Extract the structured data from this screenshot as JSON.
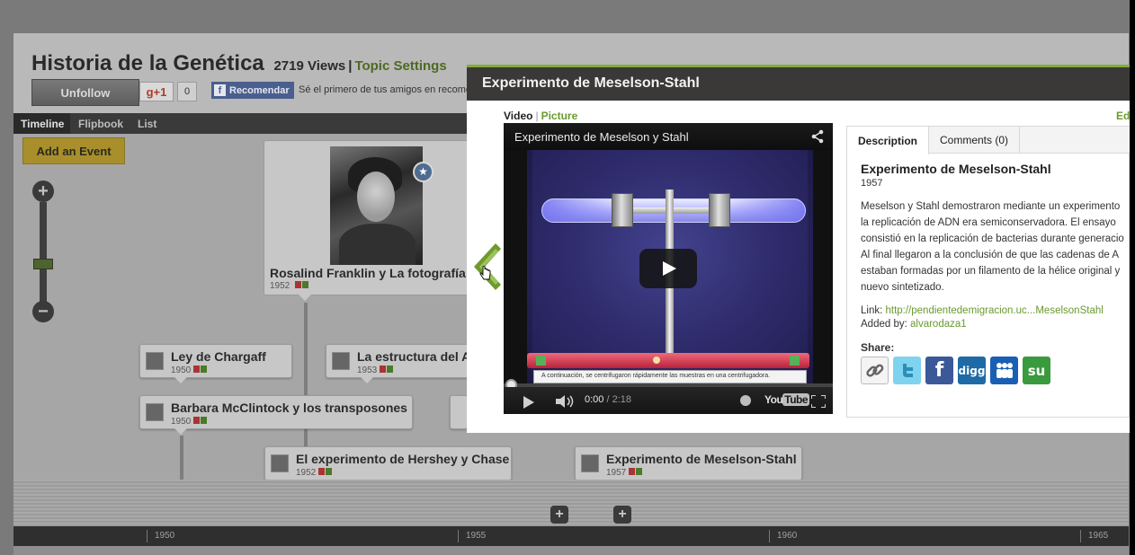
{
  "page": {
    "title": "Historia de la Genética",
    "views": "2719 Views",
    "separator": "|",
    "topic_settings": "Topic Settings",
    "unfollow": "Unfollow",
    "gplus": "g+1",
    "gplus_count": "0",
    "fb_recommend": "Recomendar",
    "fb_text": "Sé el primero de tus amigos en recome"
  },
  "nav": {
    "timeline": "Timeline",
    "flipbook": "Flipbook",
    "list": "List"
  },
  "add_event": "Add an Event",
  "zoom": {
    "plus": "+",
    "minus": "−"
  },
  "axis": {
    "ticks": [
      "1950",
      "1955",
      "1960",
      "1965"
    ]
  },
  "events": {
    "featured": {
      "title": "Rosalind Franklin y La fotografía",
      "year": "1952"
    },
    "chargaff": {
      "title": "Ley de Chargaff",
      "year": "1950"
    },
    "estructura": {
      "title": "La estructura del A",
      "year": "1953"
    },
    "mcclintock": {
      "title": "Barbara McClintock y los transposones",
      "year": "1950"
    },
    "hershey": {
      "title": "El experimento de Hershey y Chase",
      "year": "1952"
    },
    "meselson": {
      "title": "Experimento de Meselson-Stahl",
      "year": "1957"
    }
  },
  "markers": [
    "+",
    "+"
  ],
  "modal": {
    "title": "Experimento de Meselson-Stahl",
    "tab_video": "Video",
    "tab_sep": "|",
    "tab_picture": "Picture",
    "edit": "Ed",
    "video": {
      "title": "Experimento de Meselson y Stahl",
      "caption": "A continuación, se centrifugaron rápidamente las muestras en una centrifugadora.",
      "time_current": "0:00",
      "time_duration": " / 2:18",
      "logo_you": "You",
      "logo_tube": "Tube"
    },
    "panel": {
      "tab_description": "Description",
      "tab_comments": "Comments (0)",
      "title": "Experimento de Meselson-Stahl",
      "year": "1957",
      "description_lines": [
        "Meselson y Stahl demostraron mediante un experimento",
        "la replicación de ADN era semiconservadora. El ensayo",
        "consistió en la replicación de bacterias durante generacio",
        "Al final llegaron a la conclusión de que las cadenas de A",
        "estaban formadas por un filamento de la hélice original y",
        "nuevo sintetizado."
      ],
      "link_label": "Link:",
      "link_value": "http://pendientedemigracion.uc...MeselsonStahl",
      "added_label": "Added by:",
      "added_value": "alvarodaza1",
      "share_label": "Share:"
    },
    "share_icons": [
      "link-icon",
      "twitter-icon",
      "facebook-icon",
      "digg-icon",
      "myspace-icon",
      "stumbleupon-icon"
    ]
  },
  "colors": {
    "accent_green": "#7fae3a",
    "link_green": "#6a9a2e",
    "header_dark": "#3b3937",
    "facebook_blue": "#3b5998",
    "twitter_blue": "#4fc2e6",
    "digg_blue": "#1d6aa6",
    "stumble_green": "#3a9a3e"
  }
}
